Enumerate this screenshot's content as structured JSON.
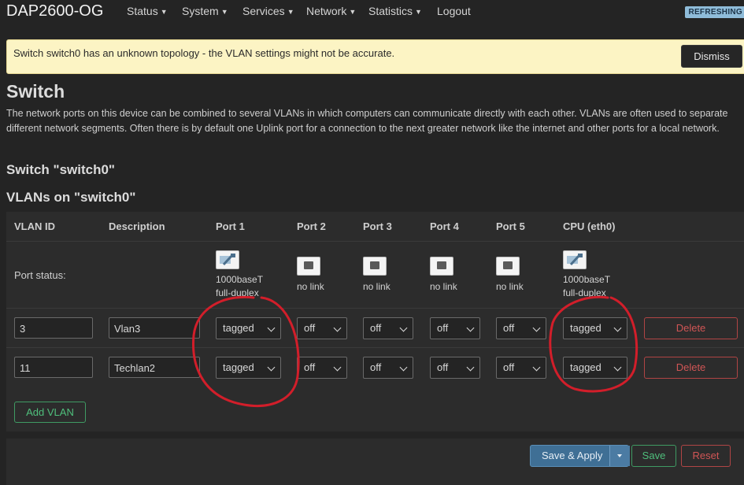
{
  "header": {
    "brand": "DAP2600-OG",
    "menu": [
      "Status",
      "System",
      "Services",
      "Network",
      "Statistics",
      "Logout"
    ],
    "badge": "REFRESHING"
  },
  "alert": {
    "message": "Switch switch0 has an unknown topology - the VLAN settings might not be accurate.",
    "dismiss_label": "Dismiss"
  },
  "page": {
    "title": "Switch",
    "description": "The network ports on this device can be combined to several VLANs in which computers can communicate directly with each other. VLANs are often used to separate different network segments. Often there is by default one Uplink port for a connection to the next greater network like the internet and other ports for a local network.",
    "section_switch": "Switch \"switch0\"",
    "section_vlans": "VLANs on \"switch0\""
  },
  "table": {
    "headers": [
      "VLAN ID",
      "Description",
      "Port 1",
      "Port 2",
      "Port 3",
      "Port 4",
      "Port 5",
      "CPU (eth0)"
    ],
    "port_status_label": "Port status:",
    "port_status": [
      {
        "state": "linked",
        "line1": "1000baseT",
        "line2": "full-duplex"
      },
      {
        "state": "nolink",
        "line1": "no link",
        "line2": ""
      },
      {
        "state": "nolink",
        "line1": "no link",
        "line2": ""
      },
      {
        "state": "nolink",
        "line1": "no link",
        "line2": ""
      },
      {
        "state": "nolink",
        "line1": "no link",
        "line2": ""
      },
      {
        "state": "linked",
        "line1": "1000baseT",
        "line2": "full-duplex"
      }
    ],
    "rows": [
      {
        "vlan_id": "3",
        "description": "Vlan3",
        "ports": [
          "tagged",
          "off",
          "off",
          "off",
          "off",
          "tagged"
        ],
        "delete_label": "Delete"
      },
      {
        "vlan_id": "11",
        "description": "Techlan2",
        "ports": [
          "tagged",
          "off",
          "off",
          "off",
          "off",
          "tagged"
        ],
        "delete_label": "Delete"
      }
    ],
    "add_vlan_label": "Add VLAN"
  },
  "footer": {
    "save_apply_label": "Save & Apply",
    "save_label": "Save",
    "reset_label": "Reset"
  },
  "colors": {
    "background": "#242424",
    "alert_background": "#fcf4c4",
    "primary_button": "#3f6f95",
    "positive": "#4fbf7c",
    "negative": "#d05555",
    "annotation": "#d21e2a"
  }
}
